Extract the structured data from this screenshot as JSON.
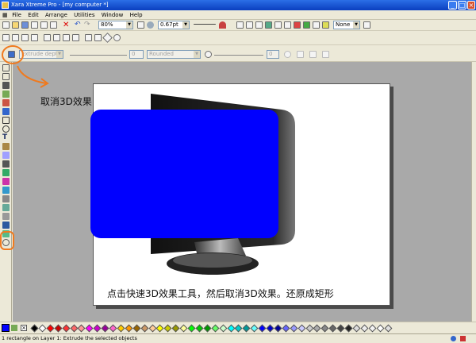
{
  "window": {
    "title": "Xara Xtreme Pro - [my computer *]",
    "min": "_",
    "max": "□",
    "close": "×"
  },
  "menu": [
    "File",
    "Edit",
    "Arrange",
    "Utilities",
    "Window",
    "Help"
  ],
  "toolbar": {
    "zoom": "80%",
    "line_width": "0.67pt",
    "fill_name": "None"
  },
  "extrude_bar": {
    "depth_placeholder": "Extrude dept",
    "depth_value": "0",
    "bevel_type": "Rounded",
    "bevel_value": "0"
  },
  "annotations": {
    "top_note": "取消3D效果",
    "bottom_note": "点击快速3D效果工具，然后取消3D效果。还原成矩形"
  },
  "palette_colors": [
    "#000000",
    "#ffffff",
    "#ff0000",
    "#cc0000",
    "#ff3333",
    "#ff6666",
    "#ff9999",
    "#ff00ff",
    "#cc00cc",
    "#990099",
    "#ff66cc",
    "#ffcc00",
    "#ff9900",
    "#996600",
    "#cc9966",
    "#ffcc99",
    "#ffff00",
    "#cccc00",
    "#999900",
    "#ffff99",
    "#00ff00",
    "#00cc00",
    "#009900",
    "#66ff66",
    "#ccffcc",
    "#00ffff",
    "#00cccc",
    "#009999",
    "#66ffff",
    "#0000ff",
    "#0000cc",
    "#000099",
    "#6666ff",
    "#9999ff",
    "#ccccff",
    "#cccccc",
    "#aaaaaa",
    "#888888",
    "#666666",
    "#444444",
    "#222222",
    "#dddddd",
    "#eeeeee",
    "#f4f4f4",
    "#ffffff",
    "#e0e0e0"
  ],
  "status": {
    "text": "1 rectangle on Layer 1: Extrude the selected objects"
  }
}
